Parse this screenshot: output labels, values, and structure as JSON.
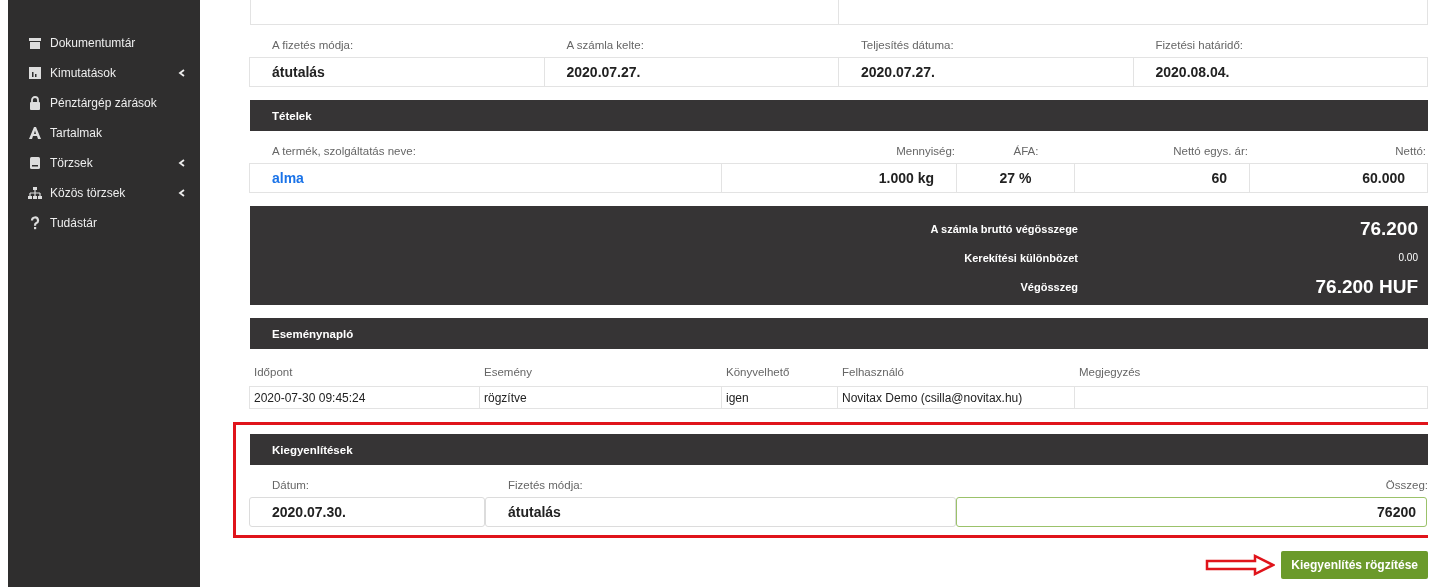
{
  "sidebar": {
    "items": [
      {
        "label": "Dokumentumtár",
        "expandable": false
      },
      {
        "label": "Kimutatások",
        "expandable": true
      },
      {
        "label": "Pénztárgép zárások",
        "expandable": false
      },
      {
        "label": "Tartalmak",
        "expandable": false
      },
      {
        "label": "Törzsek",
        "expandable": true
      },
      {
        "label": "Közös törzsek",
        "expandable": true
      },
      {
        "label": "Tudástár",
        "expandable": false
      }
    ]
  },
  "invoice": {
    "fields": [
      {
        "label": "A fizetés módja:",
        "value": "átutalás"
      },
      {
        "label": "A számla kelte:",
        "value": "2020.07.27."
      },
      {
        "label": "Teljesítés dátuma:",
        "value": "2020.07.27."
      },
      {
        "label": "Fizetési határidő:",
        "value": "2020.08.04."
      }
    ]
  },
  "items": {
    "title": "Tételek",
    "columns": [
      "A termék, szolgáltatás neve:",
      "Mennyiség:",
      "ÁFA:",
      "Nettó egys. ár:",
      "Nettó:"
    ],
    "rows": [
      {
        "cells": [
          "alma",
          "1.000 kg",
          "27 %",
          "60",
          "60.000"
        ]
      }
    ]
  },
  "totals": [
    {
      "label": "A számla bruttó végösszege",
      "value": "76.200",
      "kind": "large"
    },
    {
      "label": "Kerekítési különbözet",
      "value": "0.00",
      "kind": "small"
    },
    {
      "label": "Végösszeg",
      "value": "76.200 HUF",
      "kind": "large"
    }
  ],
  "event_log": {
    "title": "Eseménynapló",
    "columns": [
      "Időpont",
      "Esemény",
      "Könyvelhető",
      "Felhasználó",
      "Megjegyzés"
    ],
    "rows": [
      {
        "cells": [
          "2020-07-30 09:45:24",
          "rögzítve",
          "igen",
          "Novitax Demo (csilla@novitax.hu)",
          null
        ]
      }
    ]
  },
  "settlements": {
    "title": "Kiegyenlítések",
    "fields": [
      {
        "label": "Dátum:",
        "value": "2020.07.30.",
        "focused": false
      },
      {
        "label": "Fizetés módja:",
        "value": "átutalás",
        "focused": false
      },
      {
        "label": "Összeg:",
        "value": "76200",
        "focused": true
      }
    ],
    "button": "Kiegyenlítés rögzítése"
  }
}
